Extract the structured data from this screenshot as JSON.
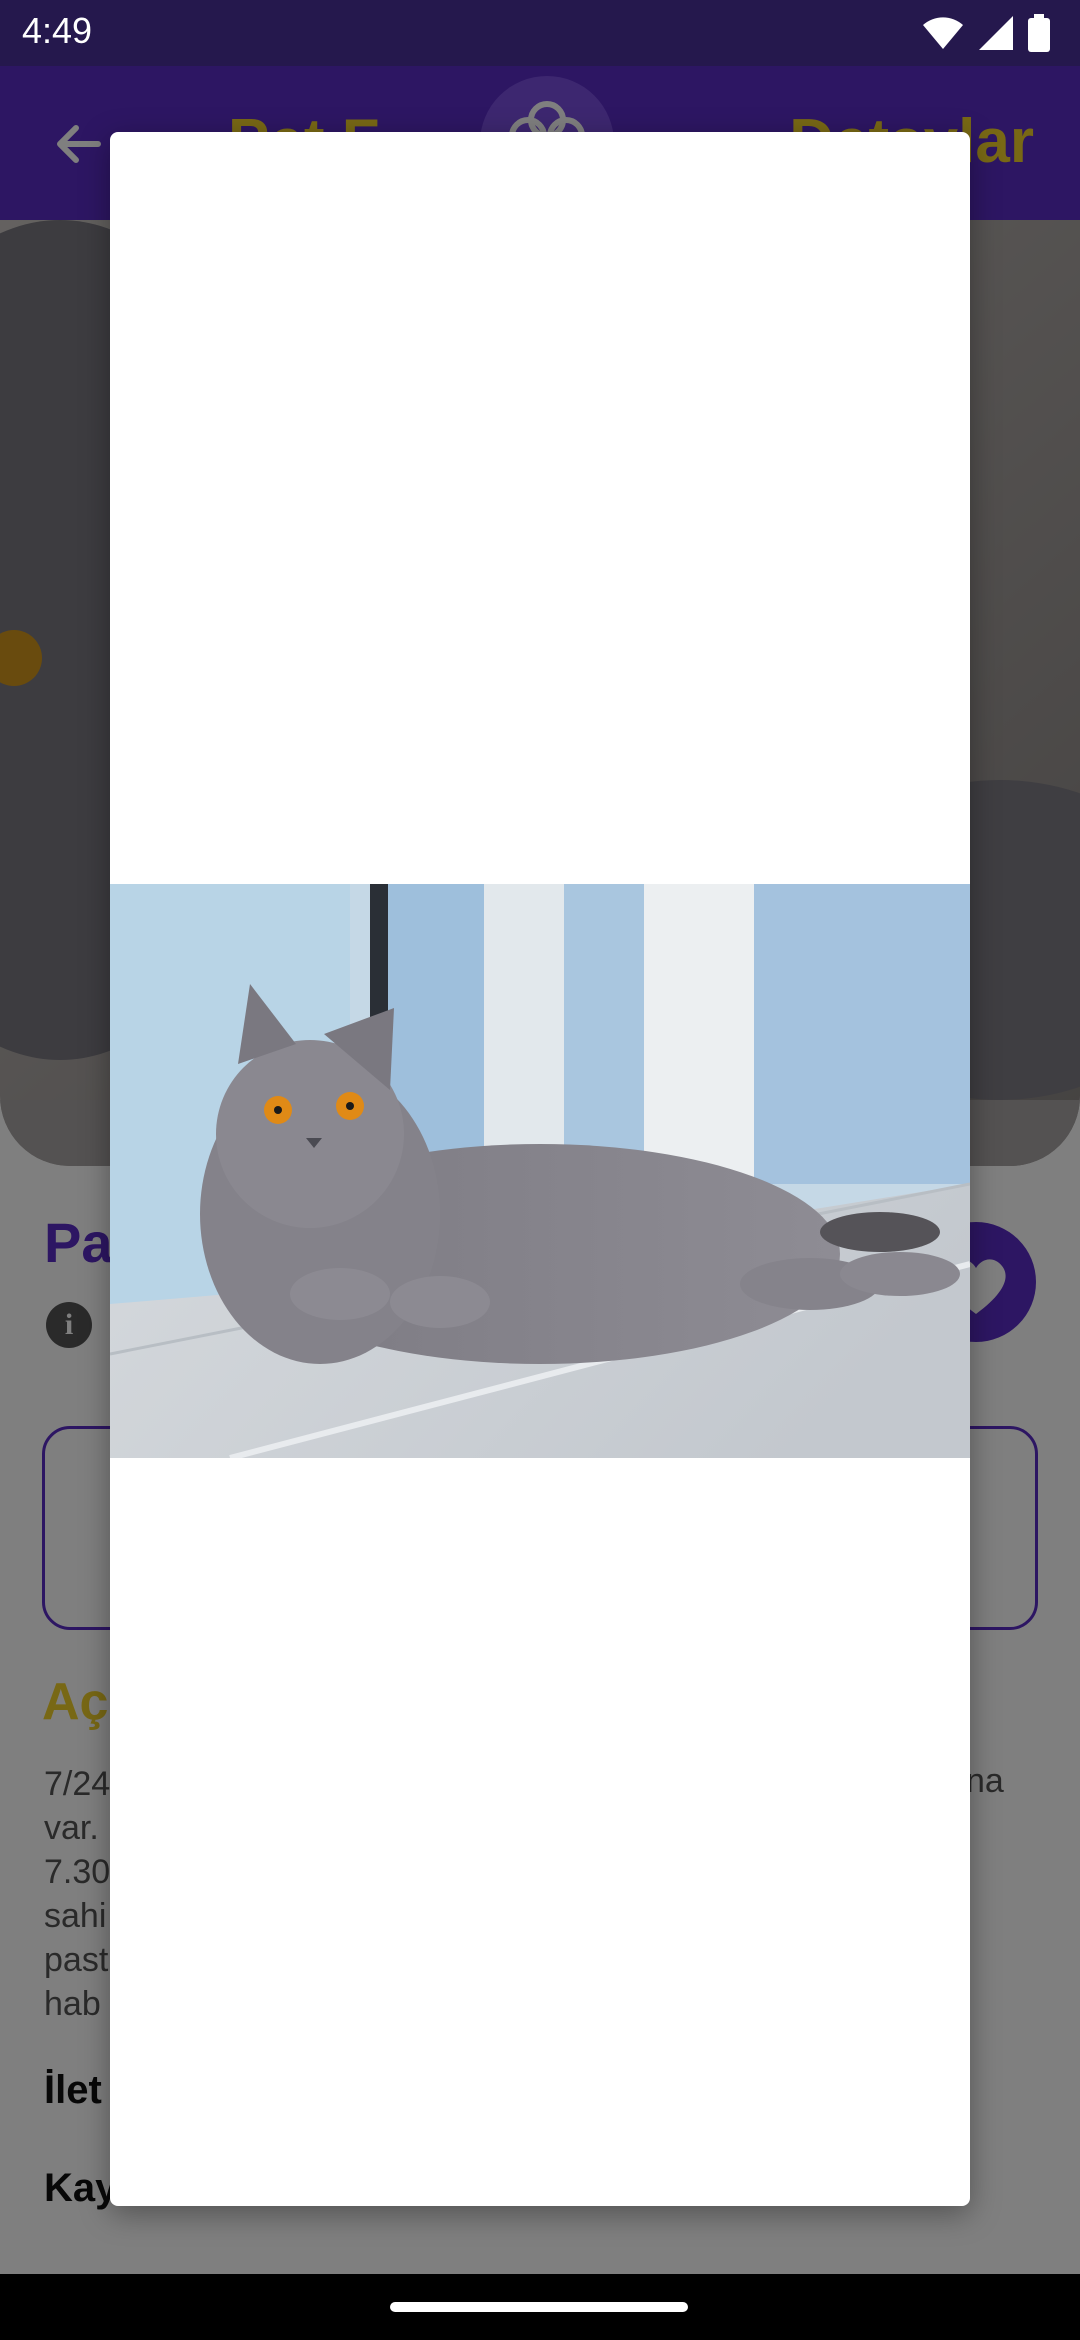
{
  "status_bar": {
    "time": "4:49",
    "icons": [
      "wifi-icon",
      "cell-signal-icon",
      "battery-icon"
    ]
  },
  "app_bar": {
    "title": "Pet F",
    "right_label": "Detaylar",
    "colors": {
      "bar": "#5a2cc6",
      "title": "#f1d02a"
    }
  },
  "pet": {
    "name": "Pa",
    "description_title": "Aç",
    "description_lines": [
      "7/24",
      "var.",
      "7.30",
      "sahi",
      "past",
      "hab"
    ],
    "description_right": "na",
    "contact_label": "İlet",
    "save_label": "Kay"
  },
  "dialog": {
    "image_alt": "gray British Shorthair cat lying on floor"
  }
}
